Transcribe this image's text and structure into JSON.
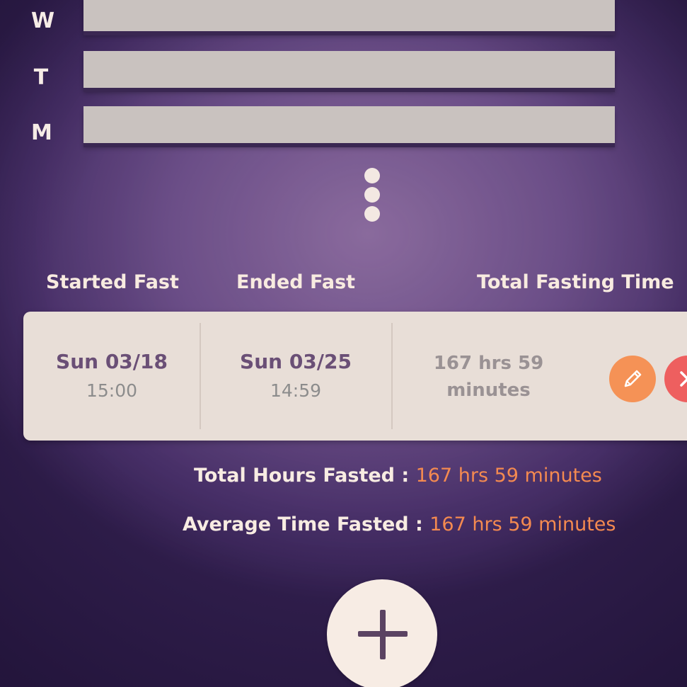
{
  "week_chart": {
    "days": [
      {
        "letter": "W"
      },
      {
        "letter": "T"
      },
      {
        "letter": "M"
      }
    ]
  },
  "columns": {
    "started": "Started Fast",
    "ended": "Ended Fast",
    "total": "Total Fasting Time"
  },
  "record": {
    "start_date": "Sun 03/18",
    "start_time": "15:00",
    "end_date": "Sun 03/25",
    "end_time": "14:59",
    "duration_line1": "167 hrs 59",
    "duration_line2": "minutes"
  },
  "summary": {
    "total_label": "Total Hours Fasted :",
    "total_value": "167 hrs 59 minutes",
    "average_label": "Average Time Fasted :",
    "average_value": "167 hrs 59 minutes"
  },
  "icons": {
    "more": "vertical-dots-icon",
    "edit": "pencil-icon",
    "delete": "close-icon",
    "add": "plus-icon"
  },
  "colors": {
    "accent_orange": "#f48a50",
    "edit_button": "#f59256",
    "delete_button": "#ee5f5f",
    "date_text": "#6a4f76"
  }
}
